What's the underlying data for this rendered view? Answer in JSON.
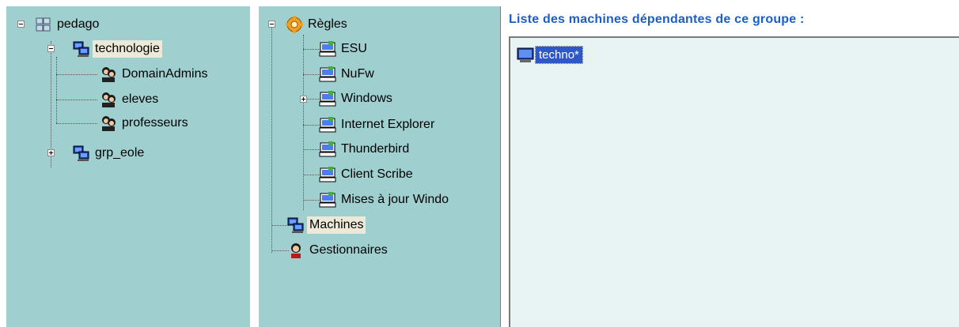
{
  "left_tree": {
    "root": {
      "label": "pedago",
      "icon": "domain-computers-icon",
      "expanded": true
    },
    "group_technologie": {
      "label": "technologie",
      "icon": "computer-group-icon",
      "expanded": true,
      "selected": true
    },
    "children": [
      {
        "label": "DomainAdmins",
        "icon": "users-group-icon"
      },
      {
        "label": "eleves",
        "icon": "users-group-icon"
      },
      {
        "label": "professeurs",
        "icon": "users-group-icon"
      }
    ],
    "group_grp_eole": {
      "label": "grp_eole",
      "icon": "computer-group-icon",
      "expanded": false
    }
  },
  "middle_tree": {
    "root": {
      "label": "Règles",
      "icon": "rules-gear-icon",
      "expanded": true
    },
    "rules": [
      {
        "label": "ESU",
        "icon": "policy-computer-icon"
      },
      {
        "label": "NuFw",
        "icon": "policy-computer-icon"
      },
      {
        "label": "Windows",
        "icon": "policy-computer-icon",
        "expandable": true
      },
      {
        "label": "Internet Explorer",
        "icon": "policy-computer-icon"
      },
      {
        "label": "Thunderbird",
        "icon": "policy-computer-icon"
      },
      {
        "label": "Client Scribe",
        "icon": "policy-computer-icon"
      },
      {
        "label": "Mises à jour Windo",
        "icon": "policy-computer-icon"
      }
    ],
    "machines": {
      "label": "Machines",
      "icon": "computer-group-icon",
      "selected": true
    },
    "managers": {
      "label": "Gestionnaires",
      "icon": "manager-user-icon"
    }
  },
  "right_panel": {
    "title": "Liste des machines dépendantes de ce groupe :",
    "machines": [
      {
        "label": "techno*",
        "icon": "computer-network-icon",
        "selected": true
      }
    ]
  },
  "colors": {
    "panel_bg": "#9fcfcf",
    "list_bg": "#e8f3f3",
    "title_blue": "#1a5fc8",
    "selection_blue": "#2f57c8",
    "selected_label_bg": "#ece9d8"
  }
}
